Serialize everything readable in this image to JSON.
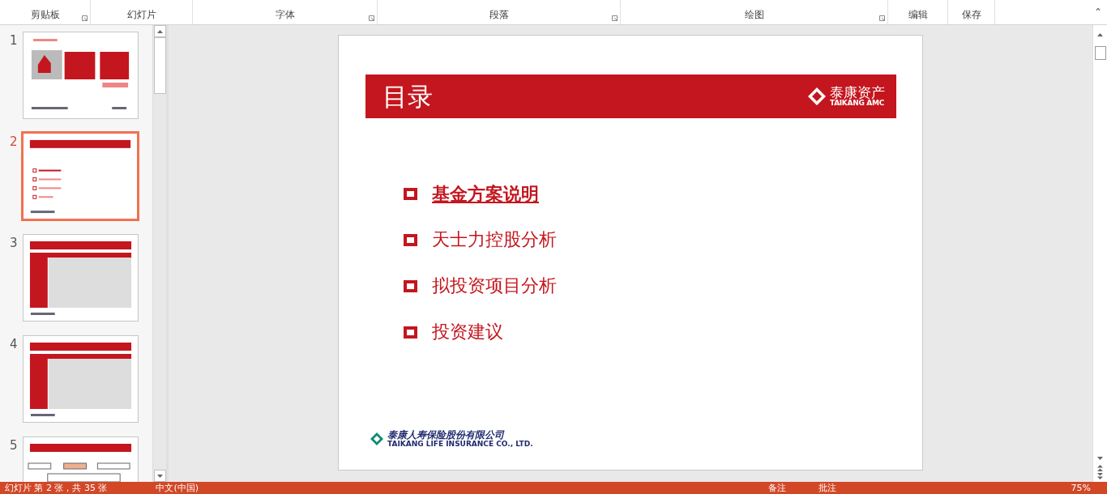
{
  "ribbon": {
    "groups": [
      {
        "label": "剪贴板",
        "launcher": true
      },
      {
        "label": "幻灯片",
        "launcher": false
      },
      {
        "label": "字体",
        "launcher": true
      },
      {
        "label": "段落",
        "launcher": true
      },
      {
        "label": "绘图",
        "launcher": true
      },
      {
        "label": "编辑",
        "launcher": false
      },
      {
        "label": "保存",
        "launcher": false
      }
    ],
    "collapse": "⌃"
  },
  "thumbnails": [
    {
      "number": "1",
      "selected": false,
      "kind": "cover"
    },
    {
      "number": "2",
      "selected": true,
      "kind": "toc"
    },
    {
      "number": "3",
      "selected": false,
      "kind": "table"
    },
    {
      "number": "4",
      "selected": false,
      "kind": "table"
    },
    {
      "number": "5",
      "selected": false,
      "kind": "chart"
    }
  ],
  "slide": {
    "title": "目录",
    "logo": {
      "name": "泰康资产",
      "english": "TAIKANG AMC"
    },
    "items": [
      {
        "text": "基金方案说明",
        "emphasized": true
      },
      {
        "text": "天士力控股分析",
        "emphasized": false
      },
      {
        "text": "拟投资项目分析",
        "emphasized": false
      },
      {
        "text": "投资建议",
        "emphasized": false
      }
    ],
    "footer": {
      "name": "泰康人寿保险股份有限公司",
      "english": "TAIKANG LIFE INSURANCE CO., LTD."
    }
  },
  "status_bar": {
    "slide_info": "幻灯片 第 2 张，共 35 张",
    "language": "中文(中国)",
    "notes": "备注",
    "comments": "批注",
    "zoom": "75%"
  }
}
